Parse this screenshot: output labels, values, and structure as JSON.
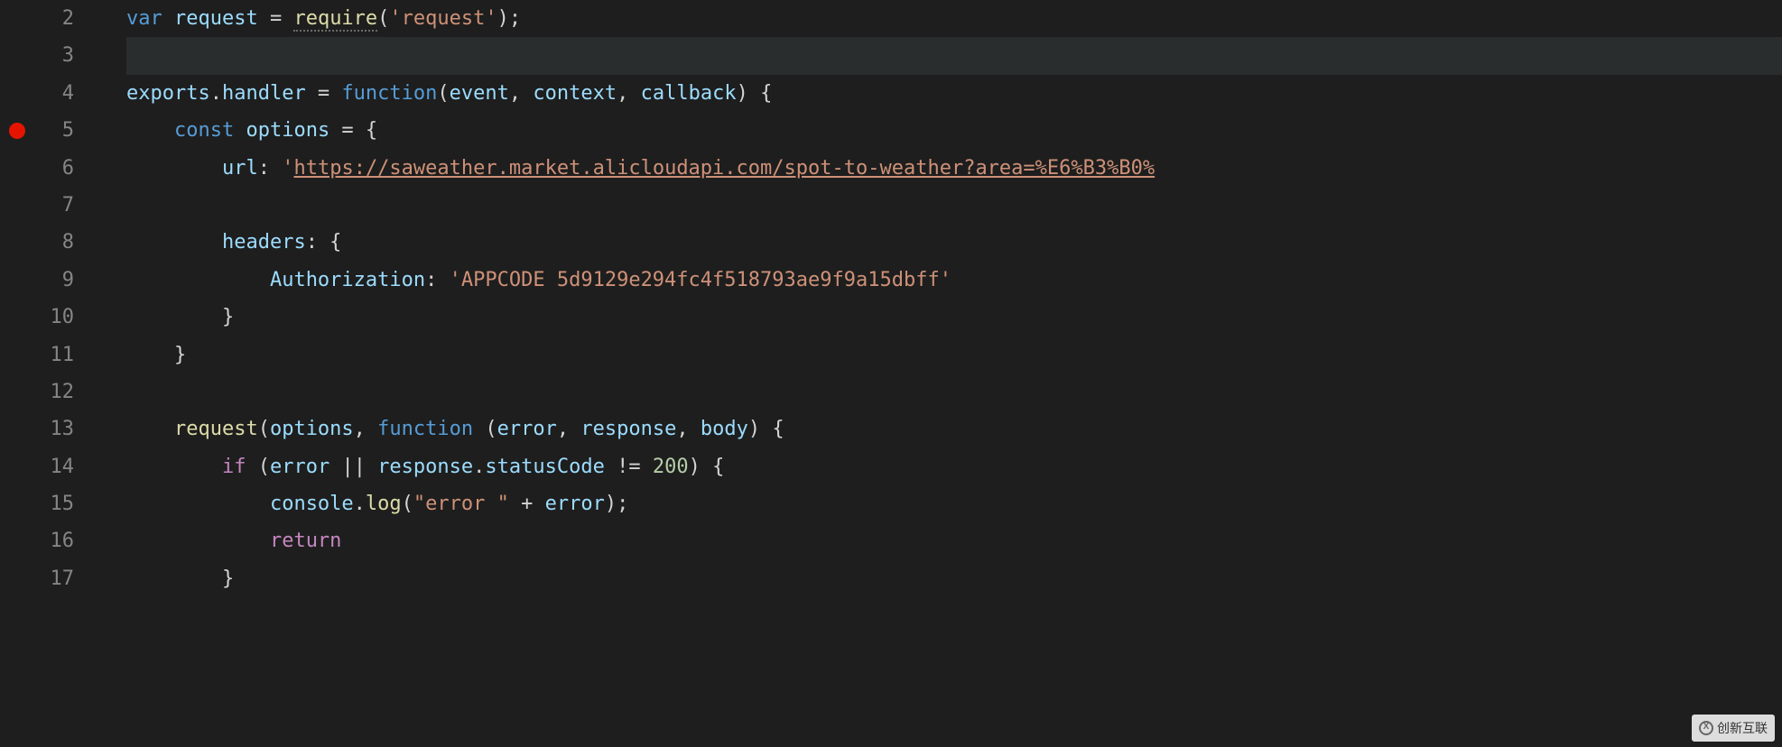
{
  "editor": {
    "language": "javascript",
    "theme": "dark-plus",
    "breakpoint_line": 5,
    "highlighted_line": 3,
    "lines": [
      {
        "num": 2,
        "tokens": [
          {
            "t": "var ",
            "c": "kw-decl"
          },
          {
            "t": "request",
            "c": "identifier"
          },
          {
            "t": " = ",
            "c": "operator"
          },
          {
            "t": "require",
            "c": "func",
            "dotted": true
          },
          {
            "t": "(",
            "c": "punct"
          },
          {
            "t": "'request'",
            "c": "string"
          },
          {
            "t": ");",
            "c": "punct"
          }
        ]
      },
      {
        "num": 3,
        "tokens": []
      },
      {
        "num": 4,
        "tokens": [
          {
            "t": "exports",
            "c": "identifier"
          },
          {
            "t": ".",
            "c": "punct"
          },
          {
            "t": "handler",
            "c": "member"
          },
          {
            "t": " = ",
            "c": "operator"
          },
          {
            "t": "function",
            "c": "kw-storage"
          },
          {
            "t": "(",
            "c": "punct"
          },
          {
            "t": "event",
            "c": "param"
          },
          {
            "t": ", ",
            "c": "punct"
          },
          {
            "t": "context",
            "c": "param"
          },
          {
            "t": ", ",
            "c": "punct"
          },
          {
            "t": "callback",
            "c": "param"
          },
          {
            "t": ") {",
            "c": "punct"
          }
        ]
      },
      {
        "num": 5,
        "indent": 1,
        "tokens": [
          {
            "t": "const ",
            "c": "kw-decl"
          },
          {
            "t": "options",
            "c": "identifier"
          },
          {
            "t": " = {",
            "c": "punct"
          }
        ]
      },
      {
        "num": 6,
        "indent": 2,
        "tokens": [
          {
            "t": "url",
            "c": "prop-label"
          },
          {
            "t": ": ",
            "c": "punct"
          },
          {
            "t": "'",
            "c": "string"
          },
          {
            "t": "https://saweather.market.alicloudapi.com/spot-to-weather?area=%E6%B3%B0%",
            "c": "string-link"
          }
        ]
      },
      {
        "num": 7,
        "indent": 2,
        "tokens": []
      },
      {
        "num": 8,
        "indent": 2,
        "tokens": [
          {
            "t": "headers",
            "c": "prop-label"
          },
          {
            "t": ": {",
            "c": "punct"
          }
        ]
      },
      {
        "num": 9,
        "indent": 3,
        "tokens": [
          {
            "t": "Authorization",
            "c": "prop-label"
          },
          {
            "t": ": ",
            "c": "punct"
          },
          {
            "t": "'APPCODE 5d9129e294fc4f518793ae9f9a15dbff'",
            "c": "string"
          }
        ]
      },
      {
        "num": 10,
        "indent": 2,
        "tokens": [
          {
            "t": "}",
            "c": "punct"
          }
        ]
      },
      {
        "num": 11,
        "indent": 1,
        "tokens": [
          {
            "t": "}",
            "c": "punct"
          }
        ]
      },
      {
        "num": 12,
        "indent": 1,
        "tokens": []
      },
      {
        "num": 13,
        "indent": 1,
        "tokens": [
          {
            "t": "request",
            "c": "func"
          },
          {
            "t": "(",
            "c": "punct"
          },
          {
            "t": "options",
            "c": "identifier"
          },
          {
            "t": ", ",
            "c": "punct"
          },
          {
            "t": "function ",
            "c": "kw-storage"
          },
          {
            "t": "(",
            "c": "punct"
          },
          {
            "t": "error",
            "c": "param"
          },
          {
            "t": ", ",
            "c": "punct"
          },
          {
            "t": "response",
            "c": "param"
          },
          {
            "t": ", ",
            "c": "punct"
          },
          {
            "t": "body",
            "c": "param"
          },
          {
            "t": ") {",
            "c": "punct"
          }
        ]
      },
      {
        "num": 14,
        "indent": 2,
        "tokens": [
          {
            "t": "if ",
            "c": "kw-control"
          },
          {
            "t": "(",
            "c": "punct"
          },
          {
            "t": "error",
            "c": "identifier"
          },
          {
            "t": " || ",
            "c": "operator"
          },
          {
            "t": "response",
            "c": "identifier"
          },
          {
            "t": ".",
            "c": "punct"
          },
          {
            "t": "statusCode",
            "c": "member"
          },
          {
            "t": " != ",
            "c": "operator"
          },
          {
            "t": "200",
            "c": "number"
          },
          {
            "t": ") {",
            "c": "punct"
          }
        ]
      },
      {
        "num": 15,
        "indent": 3,
        "tokens": [
          {
            "t": "console",
            "c": "identifier"
          },
          {
            "t": ".",
            "c": "punct"
          },
          {
            "t": "log",
            "c": "func"
          },
          {
            "t": "(",
            "c": "punct"
          },
          {
            "t": "\"error \"",
            "c": "string"
          },
          {
            "t": " + ",
            "c": "operator"
          },
          {
            "t": "error",
            "c": "identifier"
          },
          {
            "t": ");",
            "c": "punct"
          }
        ]
      },
      {
        "num": 16,
        "indent": 3,
        "tokens": [
          {
            "t": "return",
            "c": "kw-control"
          }
        ]
      },
      {
        "num": 17,
        "indent": 2,
        "tokens": [
          {
            "t": "}",
            "c": "punct"
          }
        ]
      }
    ]
  },
  "watermark": {
    "text": "创新互联",
    "icon": "X"
  }
}
